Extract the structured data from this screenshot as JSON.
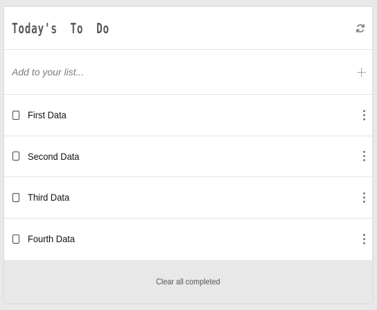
{
  "header": {
    "title": "Today's  To  Do",
    "refresh_icon": "refresh-icon"
  },
  "add": {
    "placeholder": "Add to your list...",
    "add_icon": "plus-icon"
  },
  "items": [
    {
      "label": "First Data",
      "checked": false
    },
    {
      "label": "Second Data",
      "checked": false
    },
    {
      "label": "Third Data",
      "checked": false
    },
    {
      "label": "Fourth Data",
      "checked": false
    }
  ],
  "footer": {
    "clear_label": "Clear all completed"
  },
  "colors": {
    "background": "#e9e9e9",
    "card": "#ffffff",
    "footer": "#e8e8e8",
    "divider": "#e4e4e4"
  }
}
